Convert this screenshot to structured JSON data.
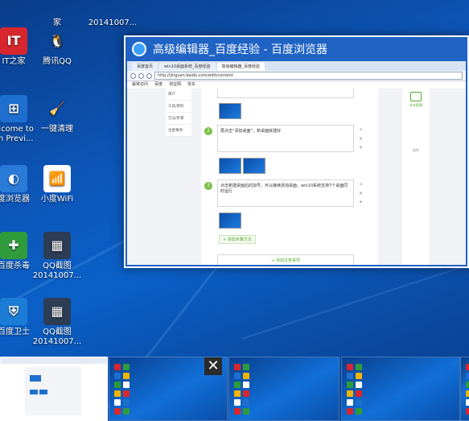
{
  "desktop_icons": [
    {
      "label": "家",
      "glyph": "",
      "color": "#444444"
    },
    {
      "label": "20141007...",
      "glyph": "",
      "color": "#444444"
    },
    {
      "label": "IT之家",
      "glyph": "IT",
      "color": "#d8262e"
    },
    {
      "label": "腾讯QQ",
      "glyph": "🐧",
      "color": "transparent"
    },
    {
      "label": "elcome to\nch Previ...",
      "glyph": "⊞",
      "color": "#1e6fd0"
    },
    {
      "label": "一键清理",
      "glyph": "🧹",
      "color": "transparent"
    },
    {
      "label": "度浏览器",
      "glyph": "◐",
      "color": "#2a7ad8"
    },
    {
      "label": "小度WiFi",
      "glyph": "📶",
      "color": "#ffffff"
    },
    {
      "label": "百度杀毒",
      "glyph": "✚",
      "color": "#2f9b3b"
    },
    {
      "label": "QQ截图\n20141007...",
      "glyph": "▦",
      "color": "#2d3d55"
    },
    {
      "label": "百度卫士",
      "glyph": "⛨",
      "color": "#1b7dd6"
    },
    {
      "label": "QQ截图\n20141007...",
      "glyph": "▦",
      "color": "#2d3d55"
    }
  ],
  "preview_window": {
    "title": "高级编辑器_百度经验 - 百度浏览器",
    "tabs": [
      "百度首页",
      "win10桌面系统_百度经验",
      "高级编辑器_百度经验"
    ],
    "url": "http://jingyan.baidu.com/edit/content",
    "bookmarks": [
      "最常访问",
      "百度",
      "淘宝网",
      "京东"
    ],
    "left_nav": [
      "简介",
      "工具/原料",
      "方法/步骤",
      "注意事项"
    ],
    "steps": [
      {
        "num": "2",
        "text": "再点击“添加桌面”，新桌面就建好"
      },
      {
        "num": "3",
        "text": "点击新建桌面后的加号，可以继续添加桌面，win10系统支持7个桌面同时运行"
      }
    ],
    "side_controls": [
      "✧",
      "×",
      "+"
    ],
    "add_step": "+ 添加步骤方法",
    "add_note": "+ 添加注意事项",
    "right_panel": [
      "文本配图",
      "图库"
    ]
  },
  "close_symbol": "✕",
  "colors": {
    "accent": "#1f63c4",
    "green": "#7bbf45"
  }
}
